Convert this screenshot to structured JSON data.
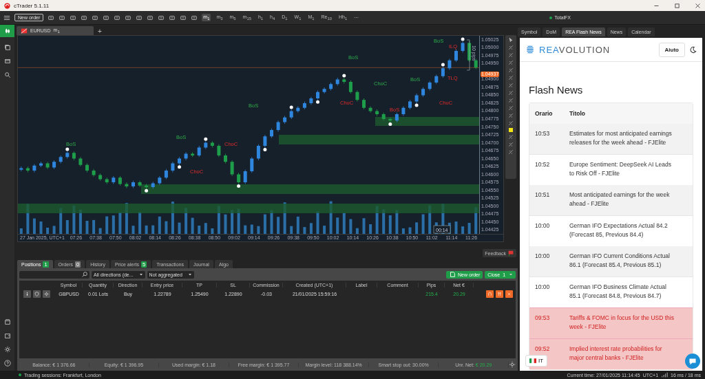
{
  "window": {
    "title": "cTrader 5.1.11"
  },
  "toolbar": {
    "new_order": "New order",
    "timeframes": [
      {
        "label": "m$_{1}$",
        "selected": true
      },
      {
        "label": "m$_{3}$",
        "selected": false
      },
      {
        "label": "m$_{5}$",
        "selected": false
      },
      {
        "label": "m$_{15}$",
        "selected": false
      },
      {
        "label": "h$_{1}$",
        "selected": false
      },
      {
        "label": "h$_{4}$",
        "selected": false
      },
      {
        "label": "D$_{1}$",
        "selected": false
      },
      {
        "label": "W$_{1}$",
        "selected": false
      },
      {
        "label": "M$_{1}$",
        "selected": false
      },
      {
        "label": "Re$_{10}$",
        "selected": false
      },
      {
        "label": "Hh$_{1}$",
        "selected": false
      }
    ],
    "more": "⋯",
    "account": "TotalFX"
  },
  "chart_tabs": [
    {
      "symbol": "EURUSD",
      "timeframe": "m$_{1}$"
    }
  ],
  "add_tab": "+",
  "chart": {
    "pips_label": "10 pips",
    "countdown": "00:14",
    "chart_data": {
      "type": "candlestick",
      "ylim": [
        1.044125,
        1.050375
      ],
      "ref_lines": [
        {
          "axis": "y",
          "value": 1.04937
        }
      ],
      "yticks": [
        {
          "value": 1.05025,
          "label": "1.05025"
        },
        {
          "value": 1.05,
          "label": "1.05000"
        },
        {
          "value": 1.04975,
          "label": "1.04975"
        },
        {
          "value": 1.0495,
          "label": "1.04950"
        },
        {
          "value": 1.049,
          "label": "1.04900"
        },
        {
          "value": 1.04875,
          "label": "1.04875"
        },
        {
          "value": 1.0485,
          "label": "1.04850"
        },
        {
          "value": 1.04825,
          "label": "1.04825"
        },
        {
          "value": 1.048,
          "label": "1.04800"
        },
        {
          "value": 1.04775,
          "label": "1.04775"
        },
        {
          "value": 1.0475,
          "label": "1.04750"
        },
        {
          "value": 1.04725,
          "label": "1.04725"
        },
        {
          "value": 1.047,
          "label": "1.04700"
        },
        {
          "value": 1.04675,
          "label": "1.04675"
        },
        {
          "value": 1.0465,
          "label": "1.04650"
        },
        {
          "value": 1.04625,
          "label": "1.04625"
        },
        {
          "value": 1.046,
          "label": "1.04600"
        },
        {
          "value": 1.04575,
          "label": "1.04575"
        },
        {
          "value": 1.0455,
          "label": "1.04550"
        },
        {
          "value": 1.04525,
          "label": "1.04525"
        },
        {
          "value": 1.045,
          "label": "1.04500"
        },
        {
          "value": 1.04475,
          "label": "1.04475"
        },
        {
          "value": 1.0445,
          "label": "1.04450"
        },
        {
          "value": 1.04425,
          "label": "1.04425"
        }
      ],
      "categories": [
        null,
        null,
        null,
        null,
        null,
        null,
        null,
        null,
        "07:26",
        null,
        null,
        "07:38",
        null,
        null,
        "07:50",
        null,
        null,
        "08:02",
        null,
        null,
        "08:14",
        null,
        null,
        "08:26",
        null,
        null,
        "08:38",
        null,
        null,
        "08:50",
        null,
        null,
        "09:02",
        null,
        null,
        "09:14",
        null,
        null,
        "09:26",
        null,
        null,
        "09:38",
        null,
        null,
        "09:50",
        null,
        null,
        "10:02",
        null,
        null,
        "10:14",
        null,
        null,
        "10:26",
        null,
        null,
        "10:38",
        null,
        null,
        "10:50",
        null,
        null,
        "11:02",
        null,
        null,
        "11:14",
        null,
        null,
        "11:26",
        null
      ],
      "ohlc": [
        [
          1.04615,
          1.04625,
          1.0461,
          1.0462
        ],
        [
          1.0462,
          1.04625,
          1.04607,
          1.04612
        ],
        [
          1.04612,
          1.04633,
          1.04607,
          1.04628
        ],
        [
          1.04628,
          1.0464,
          1.04623,
          1.04635
        ],
        [
          1.04635,
          1.0464,
          1.04617,
          1.04622
        ],
        [
          1.04622,
          1.04645,
          1.04617,
          1.0464
        ],
        [
          1.0464,
          1.0466,
          1.04635,
          1.04655
        ],
        [
          1.04655,
          1.04673,
          1.0465,
          1.04668
        ],
        [
          1.04668,
          1.04673,
          1.04645,
          1.0465
        ],
        [
          1.0465,
          1.04655,
          1.04625,
          1.0463
        ],
        [
          1.0463,
          1.04635,
          1.04607,
          1.04612
        ],
        [
          1.04612,
          1.04617,
          1.04593,
          1.04598
        ],
        [
          1.04598,
          1.04603,
          1.0458,
          1.04585
        ],
        [
          1.04585,
          1.0459,
          1.0457,
          1.04575
        ],
        [
          1.04575,
          1.04595,
          1.0457,
          1.0459
        ],
        [
          1.0459,
          1.04595,
          1.04565,
          1.0457
        ],
        [
          1.0457,
          1.04575,
          1.04557,
          1.04562
        ],
        [
          1.04562,
          1.0458,
          1.04557,
          1.04575
        ],
        [
          1.04575,
          1.0458,
          1.0456,
          1.04565
        ],
        [
          1.04565,
          1.0457,
          1.04555,
          1.0456
        ],
        [
          1.0456,
          1.04577,
          1.04555,
          1.04572
        ],
        [
          1.04572,
          1.04595,
          1.04567,
          1.0459
        ],
        [
          1.0459,
          1.04617,
          1.04585,
          1.04612
        ],
        [
          1.04612,
          1.0464,
          1.04607,
          1.04635
        ],
        [
          1.04635,
          1.04655,
          1.0463,
          1.0465
        ],
        [
          1.0465,
          1.0467,
          1.04645,
          1.04665
        ],
        [
          1.04665,
          1.0467,
          1.04655,
          1.0466
        ],
        [
          1.0466,
          1.0469,
          1.04655,
          1.04685
        ],
        [
          1.04685,
          1.04705,
          1.0468,
          1.047
        ],
        [
          1.047,
          1.04705,
          1.04685,
          1.0469
        ],
        [
          1.0469,
          1.04695,
          1.04655,
          1.0466
        ],
        [
          1.0466,
          1.04665,
          1.04635,
          1.0464
        ],
        [
          1.0464,
          1.04645,
          1.04595,
          1.046
        ],
        [
          1.046,
          1.04605,
          1.0457,
          1.04575
        ],
        [
          1.04575,
          1.04615,
          1.0457,
          1.0461
        ],
        [
          1.0461,
          1.04655,
          1.04605,
          1.0465
        ],
        [
          1.0465,
          1.04695,
          1.04645,
          1.0469
        ],
        [
          1.0469,
          1.04725,
          1.04685,
          1.0472
        ],
        [
          1.0472,
          1.04745,
          1.04715,
          1.0474
        ],
        [
          1.0474,
          1.0477,
          1.04735,
          1.04765
        ],
        [
          1.04765,
          1.04785,
          1.0476,
          1.0478
        ],
        [
          1.0478,
          1.04805,
          1.04775,
          1.048
        ],
        [
          1.048,
          1.04815,
          1.04795,
          1.0481
        ],
        [
          1.0481,
          1.0483,
          1.04805,
          1.04825
        ],
        [
          1.04825,
          1.04845,
          1.0482,
          1.0484
        ],
        [
          1.0484,
          1.04865,
          1.04835,
          1.0486
        ],
        [
          1.0486,
          1.04875,
          1.04855,
          1.0487
        ],
        [
          1.0487,
          1.0489,
          1.04865,
          1.04885
        ],
        [
          1.04885,
          1.04905,
          1.0488,
          1.049
        ],
        [
          1.049,
          1.04905,
          1.04887,
          1.04892
        ],
        [
          1.04892,
          1.04897,
          1.04855,
          1.0486
        ],
        [
          1.0486,
          1.04865,
          1.0483,
          1.04835
        ],
        [
          1.04835,
          1.0484,
          1.04805,
          1.0481
        ],
        [
          1.0481,
          1.04815,
          1.04795,
          1.048
        ],
        [
          1.048,
          1.04805,
          1.04785,
          1.0479
        ],
        [
          1.0479,
          1.04795,
          1.0477,
          1.04775
        ],
        [
          1.04775,
          1.0478,
          1.04765,
          1.0477
        ],
        [
          1.0477,
          1.04795,
          1.04765,
          1.0479
        ],
        [
          1.0479,
          1.04815,
          1.04785,
          1.0481
        ],
        [
          1.0481,
          1.04835,
          1.04805,
          1.0483
        ],
        [
          1.0483,
          1.04855,
          1.04825,
          1.0485
        ],
        [
          1.0485,
          1.04875,
          1.04845,
          1.0487
        ],
        [
          1.0487,
          1.04895,
          1.04865,
          1.0489
        ],
        [
          1.0489,
          1.04915,
          1.04885,
          1.0491
        ],
        [
          1.0491,
          1.0494,
          1.04905,
          1.04935
        ],
        [
          1.04935,
          1.04965,
          1.0493,
          1.0496
        ],
        [
          1.0496,
          1.04995,
          1.04955,
          1.0499
        ],
        [
          1.0499,
          1.0502,
          1.04985,
          1.05015
        ],
        [
          1.05015,
          1.0502,
          1.04955,
          1.0496
        ],
        [
          1.0496,
          1.04965,
          1.04932,
          1.04937
        ]
      ]
    },
    "current_price": "1.04937",
    "date_label": "27 Jan 2025, UTC+1",
    "annotations": [
      {
        "text": "BoS",
        "kind": "bos"
      },
      {
        "text": "BoS",
        "kind": "bos"
      },
      {
        "text": "ChoC",
        "kind": "choc"
      },
      {
        "text": "BoS",
        "kind": "bos"
      },
      {
        "text": "ChoC",
        "kind": "choc"
      },
      {
        "text": "BoS",
        "kind": "bos"
      },
      {
        "text": "ChoC",
        "kind": "choc"
      },
      {
        "text": "ChoC",
        "kind": "bos"
      },
      {
        "text": "BoS",
        "kind": "bos"
      },
      {
        "text": "BoS",
        "kind": "choc"
      },
      {
        "text": "ChoC",
        "kind": "choc"
      },
      {
        "text": "ILQ",
        "kind": "choc"
      },
      {
        "text": "TLQ",
        "kind": "choc"
      },
      {
        "text": "BoS",
        "kind": "bos"
      }
    ]
  },
  "side_tabs": [
    {
      "label": "Symbol",
      "selected": false
    },
    {
      "label": "DoM",
      "selected": false
    },
    {
      "label": "REA Flash News",
      "selected": true
    },
    {
      "label": "News",
      "selected": false
    },
    {
      "label": "Calendar",
      "selected": false
    }
  ],
  "news_panel": {
    "brand_accent": "REA",
    "brand_rest": "VOLUTION",
    "help_button": "Aiuto",
    "heading": "Flash News",
    "columns": [
      "Orario",
      "Titolo"
    ],
    "rows": [
      {
        "time": "10:53",
        "title": "Estimates for most anticipated earnings releases for the week ahead - FJElite",
        "highlighted": false
      },
      {
        "time": "10:52",
        "title": "Europe Sentiment: DeepSeek AI Leads to Risk Off - FJElite",
        "highlighted": false
      },
      {
        "time": "10:51",
        "title": "Most anticipated earnings for the week ahead - FJElite",
        "highlighted": false
      },
      {
        "time": "10:00",
        "title": "German IFO Expectations Actual 84.2 (Forecast 85, Previous 84.4)",
        "highlighted": false
      },
      {
        "time": "10:00",
        "title": "German IFO Current Conditions Actual 86.1 (Forecast 85.4, Previous 85.1)",
        "highlighted": false
      },
      {
        "time": "10:00",
        "title": "German IFO Business Climate Actual 85.1 (Forecast 84.8, Previous 84.7)",
        "highlighted": false
      },
      {
        "time": "09:53",
        "title": "Tariffs & FOMC in focus for the USD this week - FJElite",
        "highlighted": true
      },
      {
        "time": "09:52",
        "title": "Implied interest rate probabilities for major central banks - FJElite",
        "highlighted": true
      }
    ],
    "language": "IT"
  },
  "bottom_panel": {
    "tabs": [
      {
        "label": "Positions",
        "badge": "1",
        "color": "#1f9d48",
        "selected": true
      },
      {
        "label": "Orders",
        "badge": "0",
        "color": "#7a7a7a",
        "selected": false
      },
      {
        "label": "History",
        "selected": false
      },
      {
        "label": "Price alerts",
        "badge": "5",
        "color": "#1f9d48",
        "selected": false
      },
      {
        "label": "Transactions",
        "selected": false
      },
      {
        "label": "Journal",
        "selected": false
      },
      {
        "label": "Algo",
        "selected": false
      }
    ],
    "feedback": "Feedback",
    "direction_filter": "All directions (de...",
    "aggregation_filter": "Not aggregated",
    "new_order": "New order",
    "close": "Close",
    "close_count": "1",
    "columns": [
      "Symbol",
      "Quantity",
      "Direction",
      "Entry price",
      "TP",
      "SL",
      "Commission",
      "Created (UTC+1)",
      "Label",
      "Comment",
      "Pips",
      "Net €"
    ],
    "rows": [
      {
        "cells": [
          "GBPUSD",
          "0.01 Lots",
          "Buy",
          "1.22789",
          "1.25490",
          "1.22890",
          "-0.03",
          "21/01/2025 15:59:16",
          "",
          "",
          "215.4",
          "20.29"
        ],
        "positive": true
      }
    ],
    "summary": [
      {
        "label": "Balance:",
        "value": "€ 1 376.66",
        "highlight": false
      },
      {
        "label": "Equity:",
        "value": "€ 1 396.95",
        "highlight": false
      },
      {
        "label": "Used margin:",
        "value": "€ 1.18",
        "highlight": false
      },
      {
        "label": "Free margin:",
        "value": "€ 1 395.77",
        "highlight": false
      },
      {
        "label": "Margin level:",
        "value": "118 388.14%",
        "highlight": false
      },
      {
        "label": "Smart stop out:",
        "value": "30.00%",
        "highlight": false
      },
      {
        "label": "Unr. Net:",
        "value": "€ 20.29",
        "highlight": true
      }
    ]
  },
  "status_bar": {
    "sessions": "Trading sessions: Frankfurt, London",
    "time": "Current time: 27/01/2025 11:14:45",
    "timezone": "UTC+1",
    "latency": "16 ms / 18 ms"
  }
}
